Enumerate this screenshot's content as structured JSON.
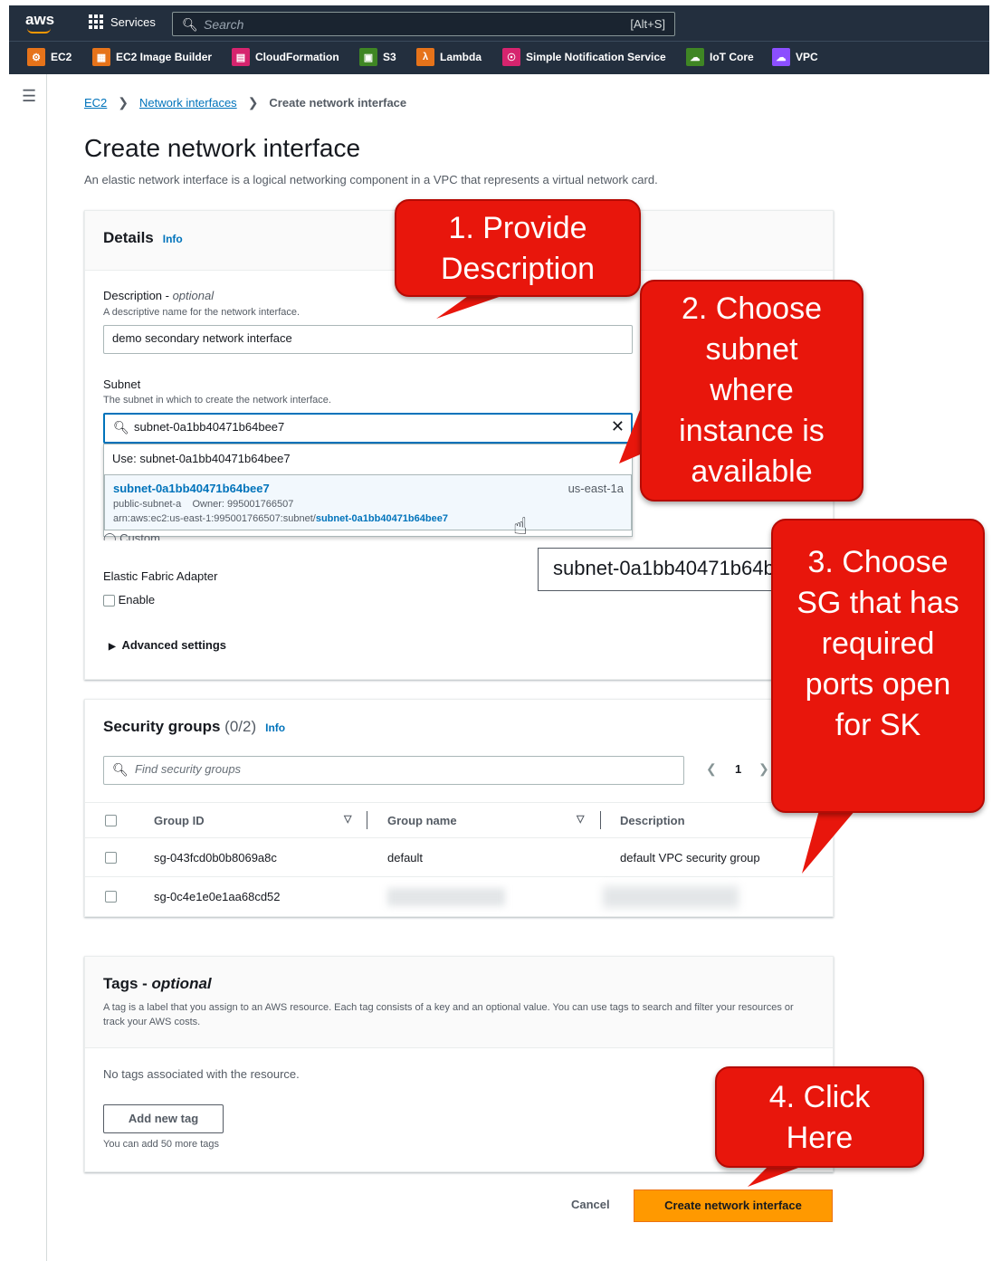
{
  "topnav": {
    "logo": "aws",
    "services_label": "Services",
    "search_placeholder": "Search",
    "search_shortcut": "[Alt+S]"
  },
  "favorites": [
    {
      "label": "EC2",
      "color": "#e6731a"
    },
    {
      "label": "EC2 Image Builder",
      "color": "#e6731a"
    },
    {
      "label": "CloudFormation",
      "color": "#d6246e"
    },
    {
      "label": "S3",
      "color": "#3f8624"
    },
    {
      "label": "Lambda",
      "color": "#e6731a"
    },
    {
      "label": "Simple Notification Service",
      "color": "#d6246e"
    },
    {
      "label": "IoT Core",
      "color": "#3f8624"
    },
    {
      "label": "VPC",
      "color": "#8c4fff"
    }
  ],
  "breadcrumb": {
    "items": [
      "EC2",
      "Network interfaces"
    ],
    "current": "Create network interface"
  },
  "page": {
    "title": "Create network interface",
    "description": "An elastic network interface is a logical networking component in a VPC that represents a virtual network card."
  },
  "details": {
    "heading": "Details",
    "info": "Info",
    "description_label": "Description - ",
    "description_optional": "optional",
    "description_hint": "A descriptive name for the network interface.",
    "description_value": "demo secondary network interface",
    "subnet_label": "Subnet",
    "subnet_hint": "The subnet in which to create the network interface.",
    "subnet_value": "subnet-0a1bb40471b64bee7",
    "use_option": "Use: subnet-0a1bb40471b64bee7",
    "option_id": "subnet-0a1bb40471b64bee7",
    "option_az": "us-east-1a",
    "option_name": "public-subnet-a",
    "option_owner": "Owner: 995001766507",
    "option_arn_prefix": "arn:aws:ec2:us-east-1:995001766507:subnet/",
    "option_arn_id": "subnet-0a1bb40471b64bee7",
    "custom_partial": "Custom",
    "efa_label": "Elastic Fabric Adapter",
    "efa_enable": "Enable",
    "advanced": "Advanced settings",
    "tooltip_text": "subnet-0a1bb40471b64bee7"
  },
  "security_groups": {
    "heading": "Security groups",
    "count": "(0/2)",
    "info": "Info",
    "search_placeholder": "Find security groups",
    "page": "1",
    "columns": [
      "Group ID",
      "Group name",
      "Description"
    ],
    "rows": [
      {
        "id": "sg-043fcd0b0b8069a8c",
        "name": "default",
        "desc": "default VPC security group"
      },
      {
        "id": "sg-0c4e1e0e1aa68cd52",
        "name": "",
        "desc": ""
      }
    ]
  },
  "tags": {
    "heading": "Tags - ",
    "heading_optional": "optional",
    "hint": "A tag is a label that you assign to an AWS resource. Each tag consists of a key and an optional value. You can use tags to search and filter your resources or track your AWS costs.",
    "empty": "No tags associated with the resource.",
    "add_button": "Add new tag",
    "remaining": "You can add 50 more tags"
  },
  "footer": {
    "cancel": "Cancel",
    "create": "Create network interface"
  },
  "callouts": {
    "c1": "1. Provide Description",
    "c2": "2. Choose subnet where instance is available",
    "c3": "3. Choose SG that has required ports open for SK",
    "c4": "4. Click Here"
  }
}
